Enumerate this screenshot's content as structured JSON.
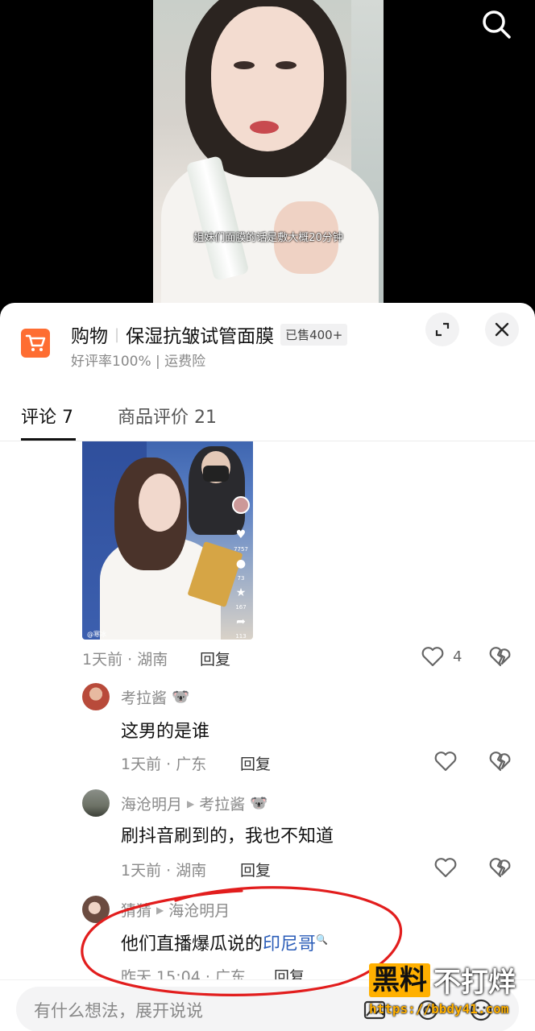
{
  "video": {
    "caption": "姐妹们面膜的话是敷大概20分钟",
    "search_icon": "search-icon"
  },
  "product": {
    "category": "购物",
    "title": "保湿抗皱试管面膜",
    "sold": "已售400+",
    "rating": "好评率100% | 运费险",
    "cart_icon": "shopping-cart-icon",
    "accent_color": "#fe6d32"
  },
  "tabs": {
    "comments": "评论 7",
    "reviews": "商品评价 21"
  },
  "comments": {
    "top": {
      "time_loc": "1天前 · 湖南",
      "reply": "回复",
      "likes": "4",
      "thumb": {
        "likes": "7757",
        "comments": "73",
        "favs": "167",
        "shares": "113",
        "handle": "@寒冰"
      }
    },
    "replies": [
      {
        "user": "考拉酱",
        "badge": "🐨",
        "text": "这男的是谁",
        "time_loc": "1天前 · 广东",
        "reply": "回复"
      },
      {
        "user": "海沧明月",
        "reply_to": "考拉酱",
        "reply_to_badge": "🐨",
        "text": "刷抖音刷到的，我也不知道",
        "time_loc": "1天前 · 湖南",
        "reply": "回复"
      },
      {
        "user": "猜猜",
        "reply_to": "海沧明月",
        "text_prefix": "他们直播爆瓜说的",
        "text_link": "印尼哥",
        "time_loc": "昨天 15:04 · 广东",
        "reply": "回复"
      }
    ]
  },
  "input": {
    "placeholder": "有什么想法，展开说说"
  },
  "watermark": {
    "box": "黑料",
    "rest": "不打烊",
    "url": "https://bbdy41.com"
  }
}
